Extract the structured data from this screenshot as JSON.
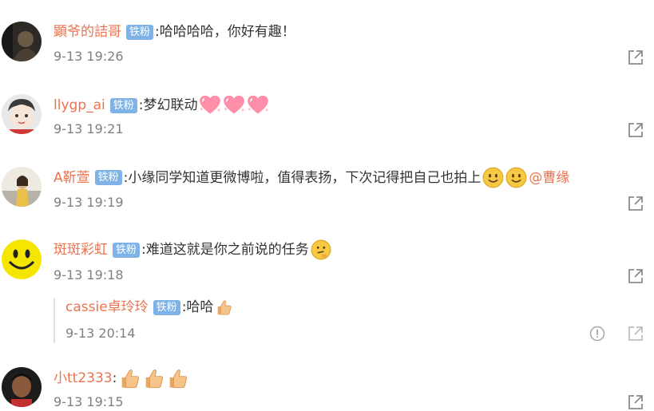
{
  "comments": [
    {
      "user": "顕爷的詰哥",
      "badge": "铁粉",
      "text": ":哈哈哈哈，你好有趣！",
      "time": "9-13 19:26"
    },
    {
      "user": "llygp_ai",
      "badge": "铁粉",
      "text": ":梦幻联动",
      "emojis": [
        "heart-emoji",
        "heart-emoji",
        "heart-emoji"
      ],
      "time": "9-13 19:21"
    },
    {
      "user": "A靳萱",
      "badge": "铁粉",
      "text": ":小缘同学知道更微博啦，值得表扬，下次记得把自己也拍上",
      "emojis": [
        "smile-emoji",
        "smile-emoji"
      ],
      "mention": "@曹缘",
      "time": "9-13 19:19"
    },
    {
      "user": "斑斑彩虹",
      "badge": "铁粉",
      "text": ":难道这就是你之前说的任务",
      "emojis": [
        "thinking-emoji"
      ],
      "time": "9-13 19:18"
    },
    {
      "user": "小tt2333",
      "badge": "",
      "text": ":",
      "emojis": [
        "thumbs-up-emoji",
        "thumbs-up-emoji",
        "thumbs-up-emoji"
      ],
      "time": "9-13 19:15"
    }
  ],
  "reply": {
    "user": "cassie卓玲玲",
    "badge": "铁粉",
    "text": ":哈哈",
    "emojis": [
      "thumbs-up-emoji"
    ],
    "time": "9-13 20:14"
  },
  "icons": {
    "share": "share-icon",
    "report": "report-icon"
  },
  "colors": {
    "username": "#eb7350",
    "badge": "#7fb3e8",
    "timestamp": "#808080"
  }
}
